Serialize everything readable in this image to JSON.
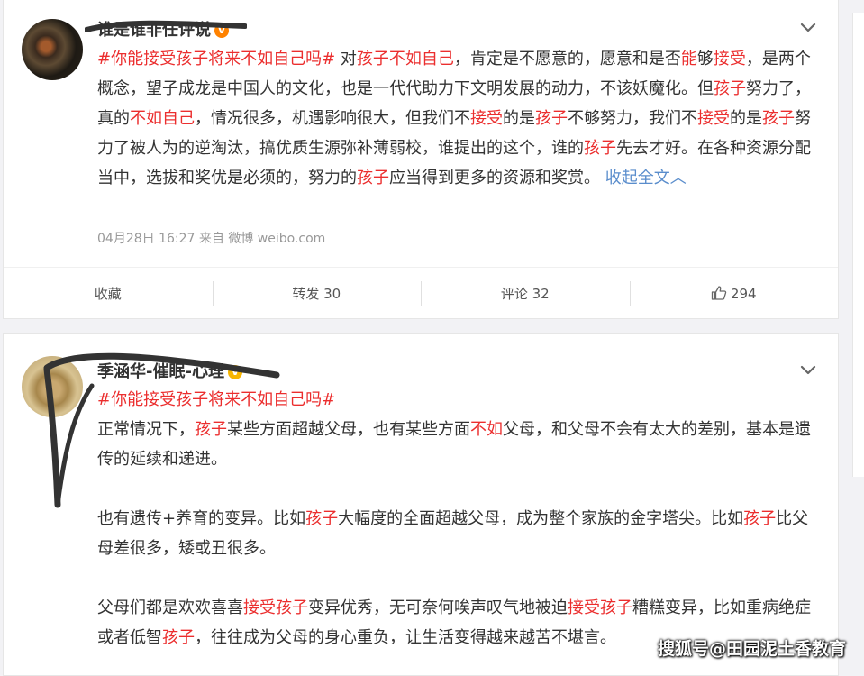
{
  "post1": {
    "nickname": "谁是谁非任评说",
    "verified": "V",
    "text": [
      {
        "t": "#你能接受孩子将来不如自己吗#",
        "s": "tag"
      },
      {
        "t": " 对",
        "s": ""
      },
      {
        "t": "孩子不如自己",
        "s": "hl"
      },
      {
        "t": "，肯定是不愿意的，愿意和是否",
        "s": ""
      },
      {
        "t": "能",
        "s": "hl"
      },
      {
        "t": "够",
        "s": ""
      },
      {
        "t": "接受",
        "s": "hl"
      },
      {
        "t": "，是两个概念，望子成龙是中国人的文化，也是一代代助力下文明发展的动力，不该妖魔化。但",
        "s": ""
      },
      {
        "t": "孩子",
        "s": "hl"
      },
      {
        "t": "努力了，真的",
        "s": ""
      },
      {
        "t": "不如自己",
        "s": "hl"
      },
      {
        "t": "，情况很多，机遇影响很大，但我们不",
        "s": ""
      },
      {
        "t": "接受",
        "s": "hl"
      },
      {
        "t": "的是",
        "s": ""
      },
      {
        "t": "孩子",
        "s": "hl"
      },
      {
        "t": "不够努力，我们不",
        "s": ""
      },
      {
        "t": "接受",
        "s": "hl"
      },
      {
        "t": "的是",
        "s": ""
      },
      {
        "t": "孩子",
        "s": "hl"
      },
      {
        "t": "努力了被人为的逆淘汰，搞优质生源弥补薄弱校，谁提出的这个，谁的",
        "s": ""
      },
      {
        "t": "孩子",
        "s": "hl"
      },
      {
        "t": "先去才好。在各种资源分配当中，选拔和奖优是必须的，努力的",
        "s": ""
      },
      {
        "t": "孩子",
        "s": "hl"
      },
      {
        "t": "应当得到更多的资源和奖赏。 ",
        "s": ""
      },
      {
        "t": "收起全文",
        "s": "blue"
      },
      {
        "t": "︿",
        "s": "blue"
      }
    ],
    "meta": "04月28日 16:27  来自 微博 weibo.com",
    "actions": {
      "favorite": "收藏",
      "repost": "转发 30",
      "comment": "评论 32",
      "like": "294"
    }
  },
  "post2": {
    "nickname": "季涵华-催眠-心理",
    "verified": "V",
    "paragraphs": [
      [
        {
          "t": "#你能接受孩子将来不如自己吗#",
          "s": "tag"
        },
        {
          "t": "\n",
          "s": "br"
        },
        {
          "t": "正常情况下，",
          "s": ""
        },
        {
          "t": "孩子",
          "s": "hl"
        },
        {
          "t": "某些方面超越父母，也有某些方面",
          "s": ""
        },
        {
          "t": "不如",
          "s": "hl"
        },
        {
          "t": "父母，和父母不会有太大的差别，基本是遗传的延续和递进。",
          "s": ""
        }
      ],
      [
        {
          "t": "也有遗传+养育的变异。比如",
          "s": ""
        },
        {
          "t": "孩子",
          "s": "hl"
        },
        {
          "t": "大幅度的全面超越父母，成为整个家族的金字塔尖。比如",
          "s": ""
        },
        {
          "t": "孩子",
          "s": "hl"
        },
        {
          "t": "比父母差很多，矮或丑很多。",
          "s": ""
        }
      ],
      [
        {
          "t": "父母们都是欢欢喜喜",
          "s": ""
        },
        {
          "t": "接受孩子",
          "s": "hl"
        },
        {
          "t": "变异优秀，无可奈何唉声叹气地被迫",
          "s": ""
        },
        {
          "t": "接受孩子",
          "s": "hl"
        },
        {
          "t": "糟糕变异，比如重病绝症或者低智",
          "s": ""
        },
        {
          "t": "孩子",
          "s": "hl"
        },
        {
          "t": "，往往成为父母的身心重负，让生活变得越来越苦不堪言。",
          "s": ""
        }
      ]
    ]
  },
  "watermark": "搜狐号@田园泥土香教育",
  "colors": {
    "highlight": "#eb2e2e",
    "link_blue": "#5a8dcc",
    "meta_gray": "#999999",
    "background": "#f2f2f5"
  },
  "icons": [
    "chevron-down-icon",
    "thumbs-up-icon",
    "verified-badge-icon"
  ]
}
